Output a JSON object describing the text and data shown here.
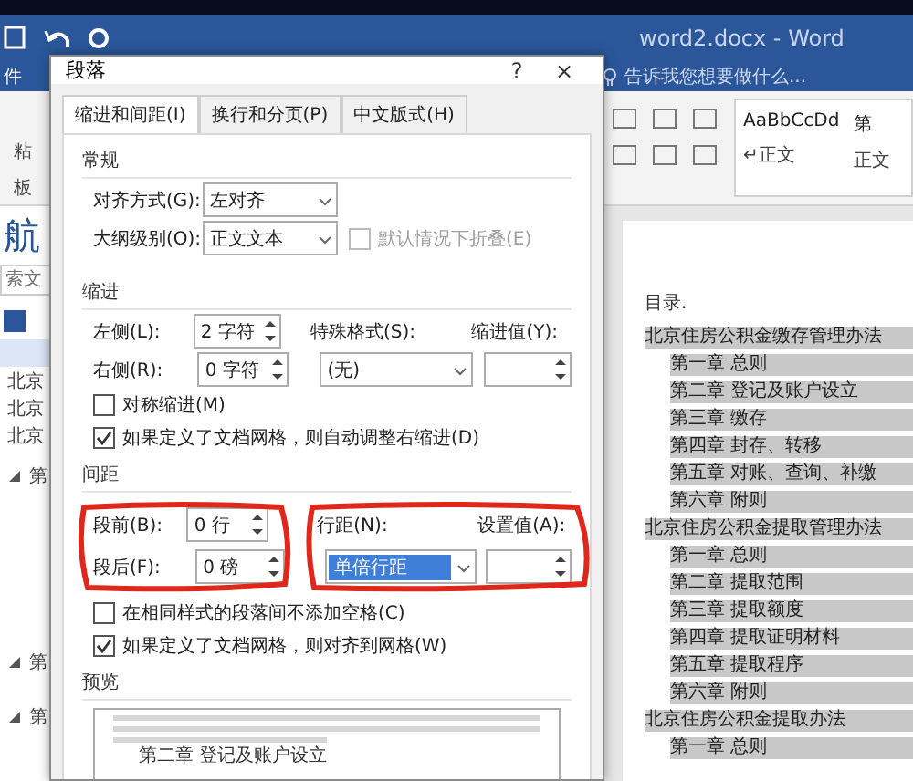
{
  "window": {
    "title": "word2.docx - Word"
  },
  "file_tab": "件",
  "tell_me": {
    "placeholder": "告诉我您想要做什么..."
  },
  "ribbon": {
    "clipboard_labels": [
      "粘",
      "板"
    ],
    "styles": [
      {
        "preview": "AaBbCcDd",
        "name": "↵正文"
      },
      {
        "preview": "第",
        "name": "正文"
      }
    ]
  },
  "nav_pane": {
    "title": "航",
    "search": {
      "placeholder": "索文"
    },
    "items": [
      {
        "kind": "blank",
        "selected": true
      },
      {
        "kind": "item",
        "label": "北京",
        "selected": false
      },
      {
        "kind": "item",
        "label": "北京",
        "selected": false
      },
      {
        "kind": "item",
        "label": "北京",
        "selected": false
      },
      {
        "kind": "heading",
        "label": "第",
        "expanded": true,
        "selected": false
      },
      {
        "kind": "heading",
        "label": "第",
        "expanded": true,
        "selected": false
      },
      {
        "kind": "heading",
        "label": "第",
        "expanded": true,
        "selected": false
      }
    ]
  },
  "document": {
    "toc_title": "目录.",
    "entries": [
      {
        "label": "北京住房公积金缴存管理办法",
        "children": [
          {
            "label": "第一章 总则"
          },
          {
            "label": "第二章 登记及账户设立"
          },
          {
            "label": "第三章 缴存"
          },
          {
            "label": "第四章 封存、转移"
          },
          {
            "label": "第五章 对账、查询、补缴"
          },
          {
            "label": "第六章 附则"
          }
        ]
      },
      {
        "label": "北京住房公积金提取管理办法",
        "children": [
          {
            "label": "第一章 总则"
          },
          {
            "label": "第二章 提取范围"
          },
          {
            "label": "第三章 提取额度"
          },
          {
            "label": "第四章 提取证明材料"
          },
          {
            "label": "第五章 提取程序"
          },
          {
            "label": "第六章 附则"
          }
        ]
      },
      {
        "label": "北京住房公积金提取办法",
        "children": [
          {
            "label": "第一章 总则"
          }
        ]
      }
    ]
  },
  "dialog": {
    "title": "段落",
    "help": "?",
    "close": "×",
    "tabs": [
      {
        "label": "缩进和间距(I)",
        "selected": true
      },
      {
        "label": "换行和分页(P)",
        "selected": false
      },
      {
        "label": "中文版式(H)",
        "selected": false
      }
    ],
    "general": {
      "title": "常规",
      "alignment": {
        "label": "对齐方式(G):",
        "value": "左对齐"
      },
      "outline_level": {
        "label": "大纲级别(O):",
        "value": "正文文本"
      },
      "collapse": {
        "label": "默认情况下折叠(E)",
        "checked": false,
        "disabled": true
      }
    },
    "indentation": {
      "title": "缩进",
      "left": {
        "label": "左侧(L):",
        "value": "2 字符"
      },
      "right": {
        "label": "右侧(R):",
        "value": "0 字符"
      },
      "special": {
        "label": "特殊格式(S):",
        "value": "(无)"
      },
      "by": {
        "label": "缩进值(Y):"
      },
      "mirror": {
        "label": "对称缩进(M)",
        "checked": false
      },
      "auto_adjust": {
        "label": "如果定义了文档网格，则自动调整右缩进(D)",
        "checked": true
      }
    },
    "spacing": {
      "title": "间距",
      "before": {
        "label": "段前(B):",
        "value": "0 行"
      },
      "after": {
        "label": "段后(F):",
        "value": "0 磅"
      },
      "line_spacing": {
        "label": "行距(N):",
        "value": "单倍行距",
        "selected": true
      },
      "at": {
        "label": "设置值(A):"
      },
      "no_space": {
        "label": "在相同样式的段落间不添加空格(C)",
        "checked": false
      },
      "snap": {
        "label": "如果定义了文档网格，则对齐到网格(W)",
        "checked": true
      }
    },
    "preview": {
      "title": "预览",
      "sample": "第二章 登记及账户设立"
    }
  }
}
